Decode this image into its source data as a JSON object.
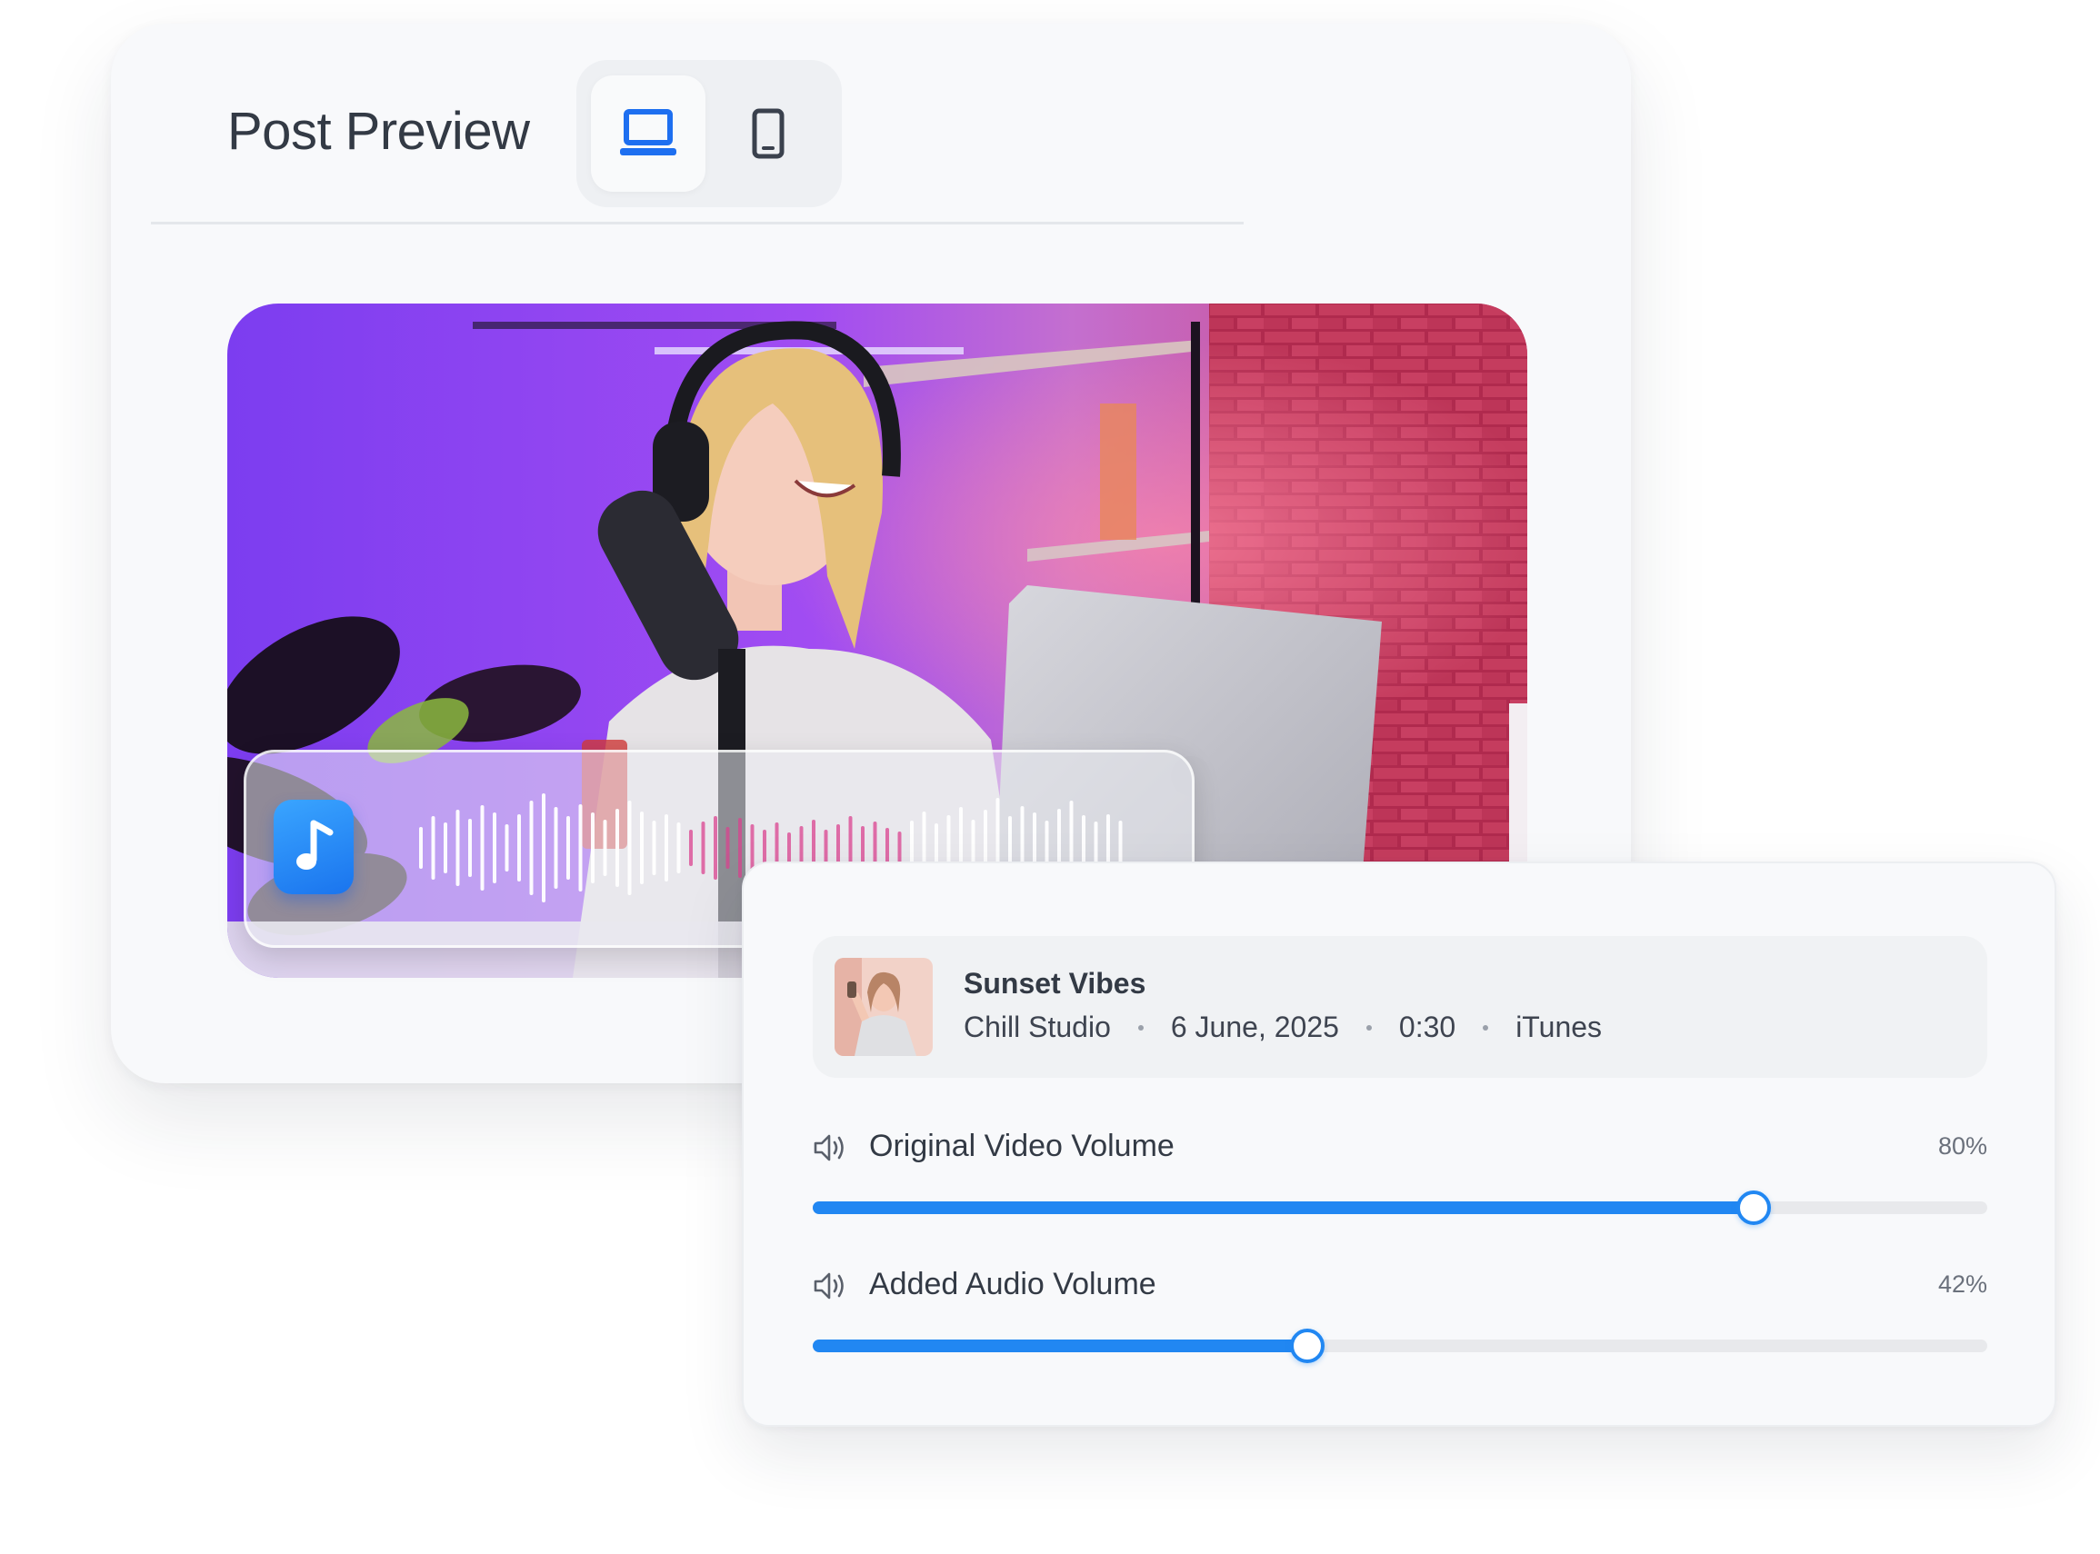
{
  "preview": {
    "title": "Post Preview",
    "devices": [
      {
        "name": "desktop-view",
        "icon": "laptop-icon",
        "selected": true
      },
      {
        "name": "mobile-view",
        "icon": "smartphone-icon",
        "selected": false
      }
    ]
  },
  "audio_overlay": {
    "icon": "music-note-icon"
  },
  "track": {
    "title": "Sunset Vibes",
    "artist": "Chill Studio",
    "date": "6 June, 2025",
    "duration": "0:30",
    "source": "iTunes"
  },
  "volumes": {
    "original": {
      "label": "Original Video Volume",
      "percent_text": "80%",
      "value": 0.8,
      "icon": "speaker-icon"
    },
    "added": {
      "label": "Added Audio Volume",
      "percent_text": "42%",
      "value": 0.42,
      "icon": "speaker-icon"
    }
  },
  "colors": {
    "accent": "#2187f2",
    "selected_icon": "#1e6ff0",
    "waveform_white": "#ffffff",
    "waveform_played": "#d9438f"
  }
}
